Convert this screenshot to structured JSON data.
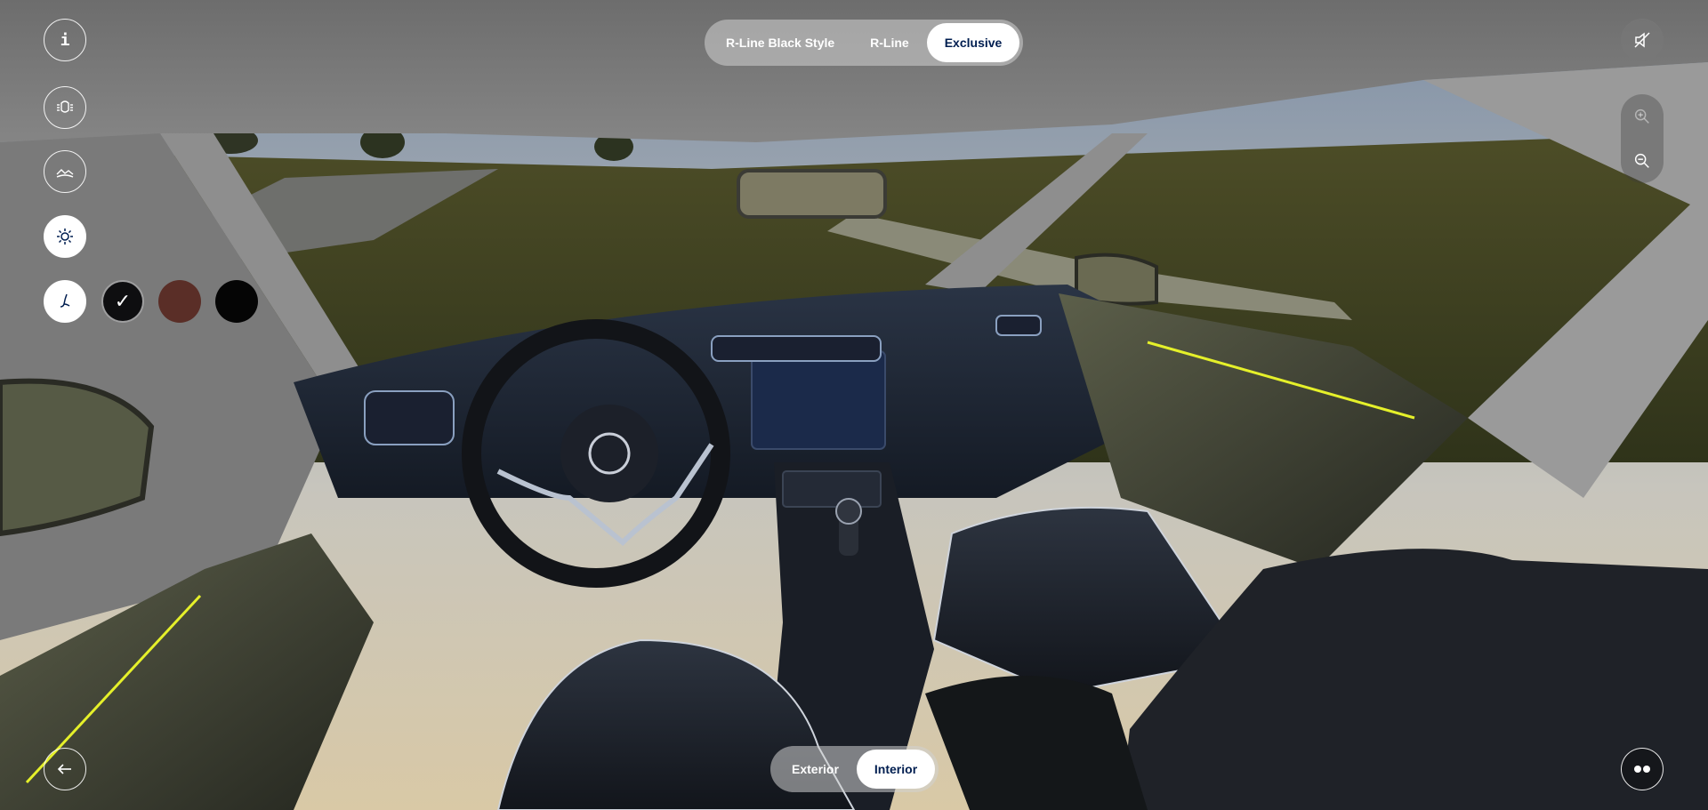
{
  "viewer": {
    "trim_options": [
      {
        "label": "R-Line Black Style",
        "active": false
      },
      {
        "label": "R-Line",
        "active": false
      },
      {
        "label": "Exclusive",
        "active": true
      }
    ],
    "view_options": [
      {
        "label": "Exterior",
        "active": false
      },
      {
        "label": "Interior",
        "active": true
      }
    ]
  },
  "left_toolbar": {
    "info_glyph": "i",
    "items": [
      {
        "icon": "info-icon"
      },
      {
        "icon": "car-lights-icon"
      },
      {
        "icon": "landscape-icon"
      },
      {
        "icon": "sun-brightness-icon",
        "active": true
      },
      {
        "icon": "seat-icon",
        "active": true
      }
    ]
  },
  "upholstery_swatches": [
    {
      "color": "#0e0e10",
      "selected": true,
      "check": "✓"
    },
    {
      "color": "#5a2e27",
      "selected": false
    },
    {
      "color": "#050505",
      "selected": false
    }
  ],
  "right_controls": {
    "icons": [
      "mute-icon",
      "zoom-in-icon",
      "zoom-out-icon",
      "vr-glasses-icon"
    ]
  },
  "bottom_left": {
    "icon": "back-arrow-icon"
  },
  "colors": {
    "accent": "#001e50",
    "ambient_light": "#e5f02a"
  }
}
